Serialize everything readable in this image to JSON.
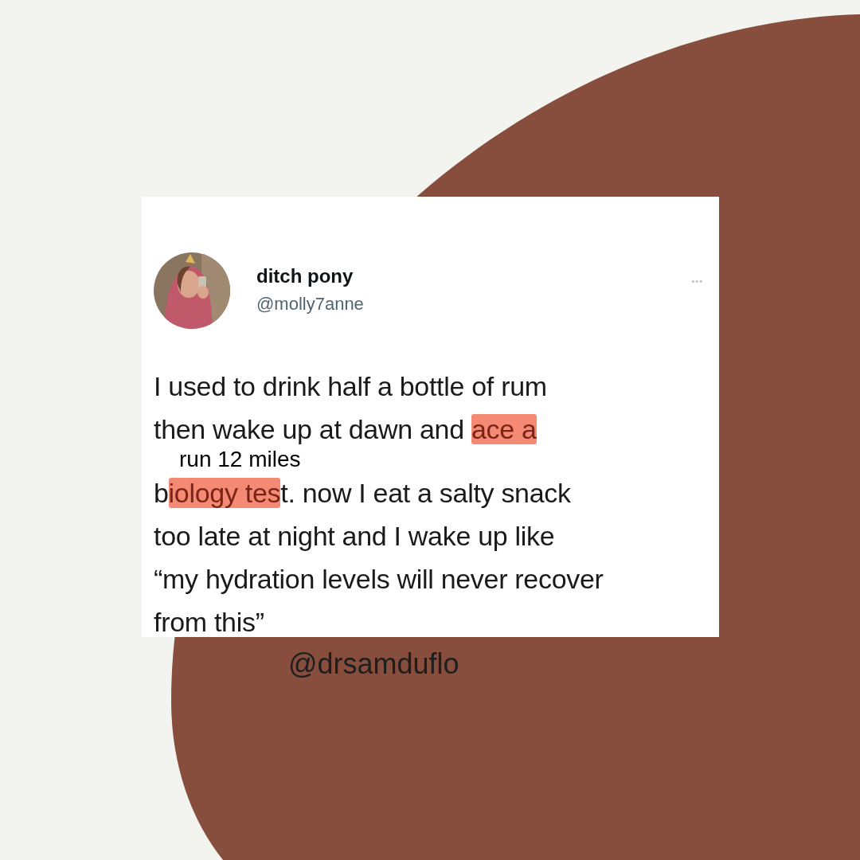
{
  "tweet": {
    "author": {
      "name": "ditch pony",
      "handle": "@molly7anne"
    },
    "menu": "•••",
    "lines": [
      [
        {
          "kind": "plain",
          "text": "I used to drink half a bottle of rum"
        }
      ],
      [
        {
          "kind": "plain",
          "text": "then wake up at dawn and "
        },
        {
          "kind": "scribbled",
          "text": "ace a"
        }
      ],
      [
        {
          "kind": "plain",
          "text": "b"
        },
        {
          "kind": "scribbled",
          "text": "iology tes"
        },
        {
          "kind": "plain",
          "text": "t. now I eat a salty snack"
        }
      ],
      [
        {
          "kind": "plain",
          "text": "too late at night and I wake up like"
        }
      ],
      [
        {
          "kind": "plain",
          "text": "“my hydration levels will never recover"
        }
      ],
      [
        {
          "kind": "plain",
          "text": "from this”"
        }
      ]
    ],
    "correction": "run 12 miles"
  },
  "credit": "@drsamduflo"
}
